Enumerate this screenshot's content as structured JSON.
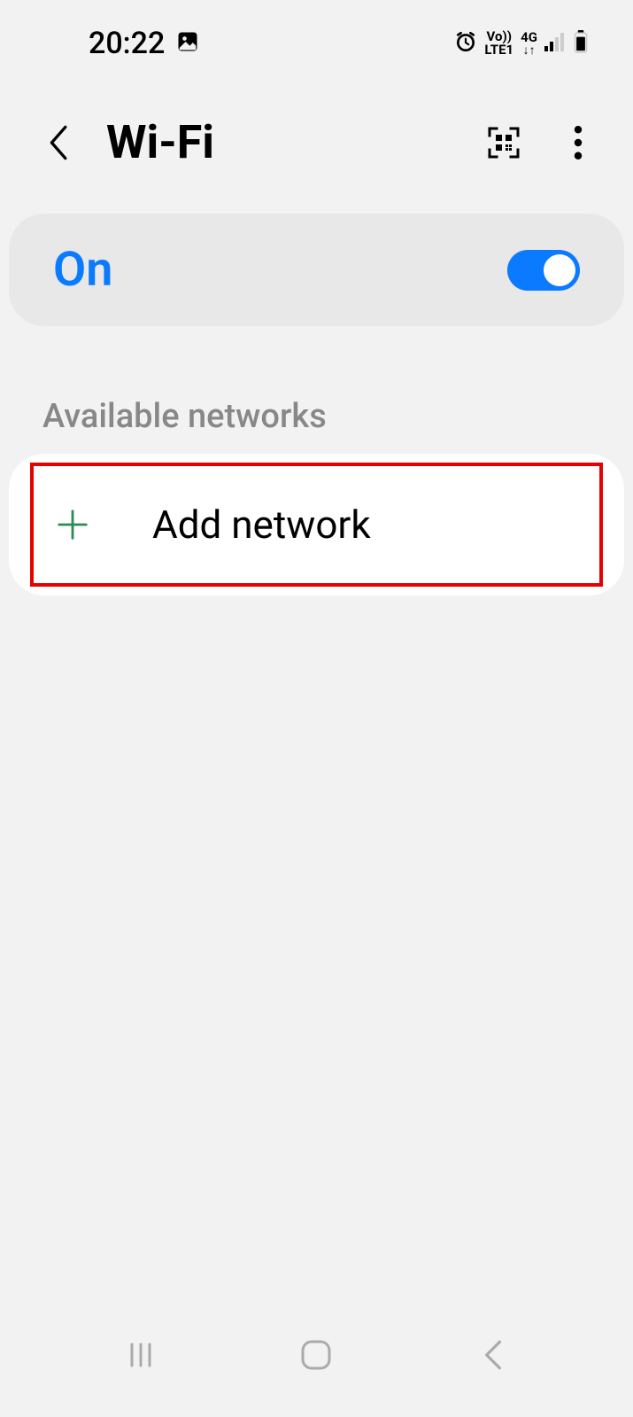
{
  "status_bar": {
    "time": "20:22",
    "volte_label": "Vo))",
    "lte_label": "LTE1",
    "network_type": "4G"
  },
  "header": {
    "title": "Wi-Fi"
  },
  "wifi": {
    "status": "On",
    "enabled": true
  },
  "sections": {
    "available_networks": "Available networks"
  },
  "actions": {
    "add_network": "Add network"
  }
}
